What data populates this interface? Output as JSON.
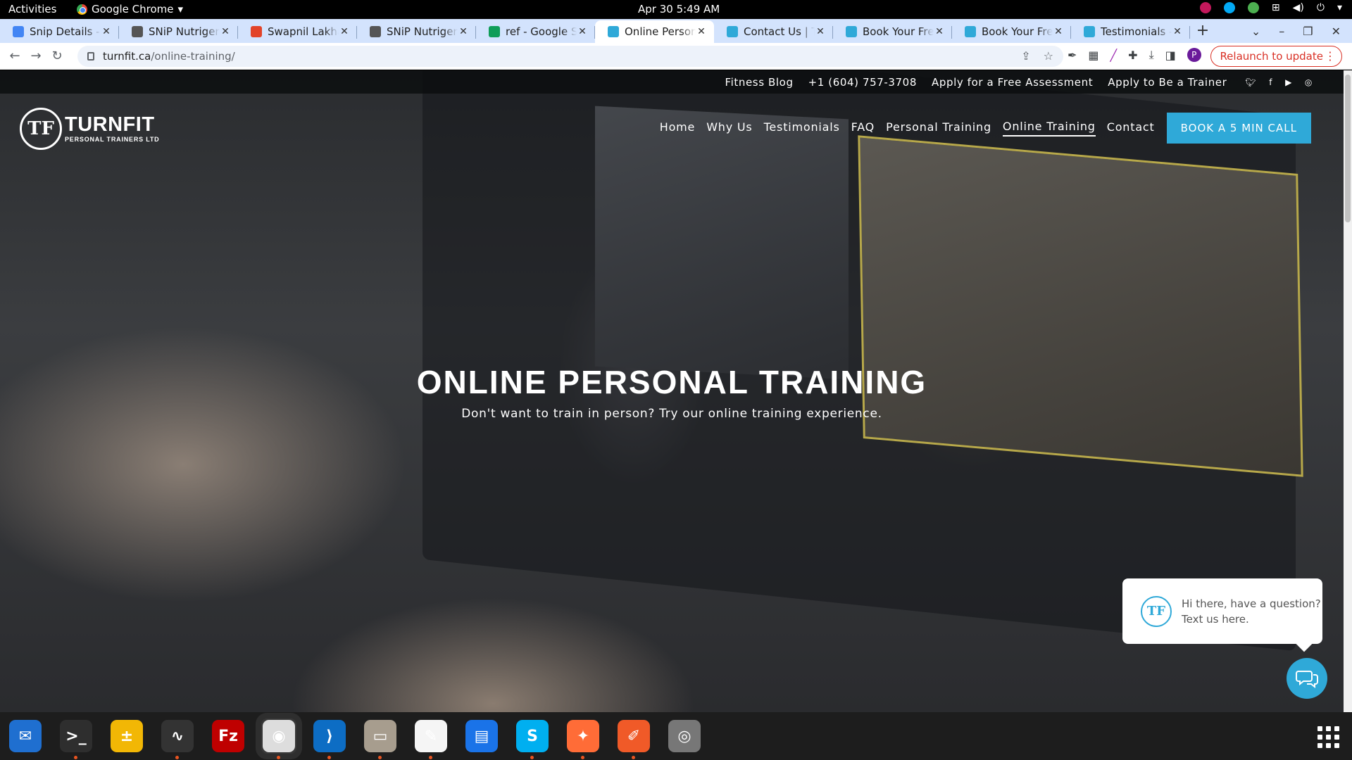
{
  "system_bar": {
    "activities": "Activities",
    "app_name": "Google Chrome",
    "app_menu": "▾",
    "clock": "Apr 30  5:49 AM"
  },
  "tabs": [
    {
      "title": "Snip Details - G",
      "favicon": "doc-icon",
      "color": "#4285f4"
    },
    {
      "title": "SNiP Nutrigeno",
      "favicon": "snip-icon",
      "color": "#555555"
    },
    {
      "title": "Swapnil Lakhan",
      "favicon": "gitlab-icon",
      "color": "#e24329"
    },
    {
      "title": "SNiP Nutrigeno",
      "favicon": "snip-icon",
      "color": "#555555"
    },
    {
      "title": "ref - Google Shee",
      "favicon": "sheets-icon",
      "color": "#0f9d58"
    },
    {
      "title": "Online Persona",
      "favicon": "turnfit-icon",
      "color": "#2fa9d8",
      "active": true
    },
    {
      "title": "Contact Us | Tur",
      "favicon": "turnfit-icon",
      "color": "#2fa9d8"
    },
    {
      "title": "Book Your Free",
      "favicon": "turnfit-icon",
      "color": "#2fa9d8"
    },
    {
      "title": "Book Your Free",
      "favicon": "turnfit-icon",
      "color": "#2fa9d8"
    },
    {
      "title": "Testimonials - T",
      "favicon": "turnfit-icon",
      "color": "#2fa9d8"
    }
  ],
  "browser": {
    "url_host": "turnfit.ca",
    "url_path": "/online-training/",
    "relaunch": "Relaunch to update",
    "profile_initial": "P"
  },
  "site": {
    "topbar_links": [
      "Fitness Blog",
      "+1 (604) 757-3708",
      "Apply for a Free Assessment",
      "Apply to Be a Trainer"
    ],
    "social": [
      "twitter-icon",
      "facebook-icon",
      "youtube-icon",
      "instagram-icon"
    ],
    "logo_mark": "TF",
    "logo_name": "TURNFIT",
    "logo_tagline": "PERSONAL TRAINERS LTD",
    "nav": [
      {
        "label": "Home"
      },
      {
        "label": "Why Us"
      },
      {
        "label": "Testimonials"
      },
      {
        "label": "FAQ"
      },
      {
        "label": "Personal Training"
      },
      {
        "label": "Online Training",
        "current": true
      },
      {
        "label": "Contact"
      }
    ],
    "cta": "BOOK A 5 MIN CALL",
    "hero_title": "ONLINE PERSONAL TRAINING",
    "hero_subtitle": "Don't want to train in person? Try our online training experience.",
    "chat_text": "Hi there, have a question? Text us here.",
    "accent": "#2fa9d8"
  },
  "dock": [
    {
      "name": "thunderbird-icon",
      "bg": "#1f6fd0",
      "glyph": "✉",
      "running": false
    },
    {
      "name": "terminal-icon",
      "bg": "#2e2e2e",
      "glyph": ">_",
      "running": true
    },
    {
      "name": "calculator-icon",
      "bg": "#f2b705",
      "glyph": "±",
      "running": false
    },
    {
      "name": "system-monitor-icon",
      "bg": "#333333",
      "glyph": "∿",
      "running": true
    },
    {
      "name": "filezilla-icon",
      "bg": "#bf0000",
      "glyph": "Fz",
      "running": false
    },
    {
      "name": "chrome-icon",
      "bg": "#dddddd",
      "glyph": "◉",
      "running": true,
      "active": true
    },
    {
      "name": "vscode-icon",
      "bg": "#0d6dc4",
      "glyph": "⟩",
      "running": true
    },
    {
      "name": "files-icon",
      "bg": "#a79d8e",
      "glyph": "▭",
      "running": true
    },
    {
      "name": "text-editor-icon",
      "bg": "#f5f5f5",
      "glyph": "✎",
      "running": true
    },
    {
      "name": "document-viewer-icon",
      "bg": "#1a73e8",
      "glyph": "▤",
      "running": false
    },
    {
      "name": "skype-icon",
      "bg": "#00aff0",
      "glyph": "S",
      "running": true
    },
    {
      "name": "postman-icon",
      "bg": "#ff6c37",
      "glyph": "✦",
      "running": true
    },
    {
      "name": "pencil-app-icon",
      "bg": "#f05a28",
      "glyph": "✐",
      "running": true
    },
    {
      "name": "disk-icon",
      "bg": "#777777",
      "glyph": "◎",
      "running": false
    }
  ]
}
